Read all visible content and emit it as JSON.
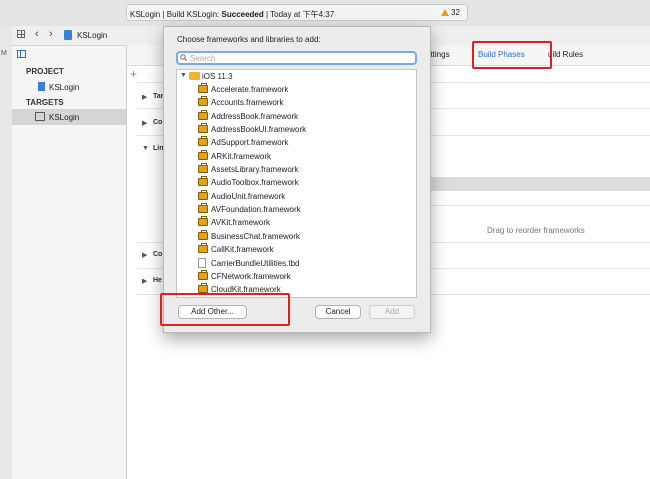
{
  "status": {
    "project": "KSLogin",
    "build_prefix": "Build KSLogin:",
    "build_result": "Succeeded",
    "time": "Today at 下午4:37",
    "warnings": "32"
  },
  "toolbar": {
    "breadcrumb": "KSLogin"
  },
  "navigator": {
    "project_header": "PROJECT",
    "project_item": "KSLogin",
    "targets_header": "TARGETS",
    "target_item": "KSLogin"
  },
  "tabs": {
    "settings": "ettings",
    "phases": "Build Phases",
    "rules": "uild Rules"
  },
  "phases": [
    {
      "label": "Tar"
    },
    {
      "label": "Co"
    },
    {
      "label": "Lin"
    },
    {
      "label": "Co"
    },
    {
      "label": "He"
    }
  ],
  "drag_hint": "Drag to reorder frameworks",
  "dialog": {
    "title": "Choose frameworks and libraries to add:",
    "search_placeholder": "Search",
    "group_label": "iOS 11.3",
    "items": [
      "Accelerate.framework",
      "Accounts.framework",
      "AddressBook.framework",
      "AddressBookUI.framework",
      "AdSupport.framework",
      "ARKit.framework",
      "AssetsLibrary.framework",
      "AudioToolbox.framework",
      "AudioUnit.framework",
      "AVFoundation.framework",
      "AVKit.framework",
      "BusinessChat.framework",
      "CallKit.framework",
      "CarrierBundleUtilities.tbd",
      "CFNetwork.framework",
      "CloudKit.framework"
    ],
    "add_other": "Add Other...",
    "cancel": "Cancel",
    "add": "Add"
  },
  "colors": {
    "accent": "#2d6fdc",
    "highlight": "#e02020",
    "folder": "#f0b631"
  }
}
